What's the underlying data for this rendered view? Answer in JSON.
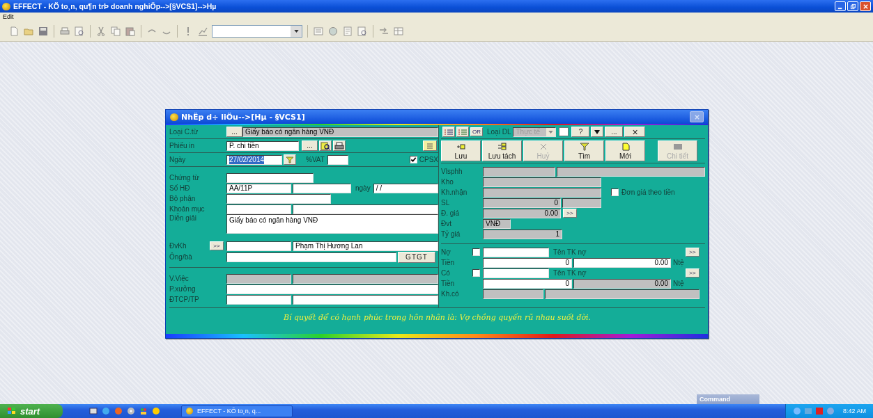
{
  "window": {
    "title": "EFFECT - KÕ to¸n, qu¶n trÞ doanh nghiÖp-->[§VCS1]-->Hµ"
  },
  "menu": [
    {
      "label": "Edit"
    }
  ],
  "dialog": {
    "title": "NhËp d÷ liÖu-->[Hµ - §VCS1]",
    "left": {
      "loai_ctu": {
        "label": "Loại C.từ",
        "button": "...",
        "field": {
          "value": "Giấy báo có ngân hàng  VNĐ",
          "disabled": true
        }
      },
      "phieu_in": {
        "label": "Phiếu in",
        "field": {
          "value": "P. chi tiền",
          "disabled": false
        },
        "button": "..."
      },
      "ngay": {
        "label": "Ngày",
        "field": {
          "value": "27/02/2014",
          "disabled": false,
          "selected": true
        },
        "vat_label": "%VAT",
        "vat": {
          "disabled": false
        },
        "cpsx": {
          "label": "CPSX",
          "checked": true
        }
      },
      "chung_tu": {
        "label": "Chứng từ",
        "field": {
          "disabled": false
        }
      },
      "so_hd": {
        "label": "Số HĐ",
        "field": {
          "value": "AA/11P",
          "disabled": false
        },
        "field_2": {
          "disabled": false
        },
        "date_label": "ngày",
        "date": {
          "value": "/ /",
          "disabled": false
        }
      },
      "bo_phan": {
        "label": "Bộ phận",
        "field": {
          "disabled": false
        }
      },
      "khoan_muc": {
        "label": "Khoản mục",
        "field": {
          "disabled": false
        },
        "field_2": {
          "disabled": false
        }
      },
      "dien_giai": {
        "label": "Diễn giải",
        "field": {
          "value": "Giấy báo có ngân hàng  VNĐ",
          "disabled": false
        }
      },
      "dvkh": {
        "label": "ĐvKh",
        "button": ">>",
        "field": {
          "disabled": false
        },
        "field_2": {
          "value": "Phạm Thị Hương Lan",
          "disabled": false
        }
      },
      "ong_ba": {
        "label": "Ông/bà",
        "field": {
          "disabled": false
        },
        "button": "GTGT"
      },
      "v_viec": {
        "label": "V.Việc",
        "field": {
          "disabled": true
        },
        "field_2": {
          "disabled": true
        }
      },
      "p_xuong": {
        "label": "P.xưởng",
        "field": {
          "disabled": false
        }
      },
      "dtcp": {
        "label": "ĐTCP/TP",
        "field": {
          "disabled": false
        },
        "field_2": {
          "disabled": false
        }
      }
    },
    "right": {
      "toolbar": {
        "or": "OR",
        "loai_dl_label": "Loại DL",
        "loai_dl": {
          "value": "Thực tế",
          "disabled": true
        },
        "help": "?",
        "more": "...",
        "close": "×"
      },
      "actions": [
        {
          "label": "Lưu",
          "disabled": false
        },
        {
          "label": "Lưu tách",
          "disabled": false
        },
        {
          "label": "Huỷ",
          "disabled": true
        },
        {
          "label": "Tìm",
          "disabled": false
        },
        {
          "label": "Mới",
          "disabled": false
        },
        {
          "label": "Chi tiết",
          "disabled": true
        }
      ],
      "vlsphh": {
        "label": "Vlsphh",
        "field": {
          "disabled": true
        },
        "field_2": {
          "disabled": true
        }
      },
      "kho": {
        "label": "Kho",
        "field": {
          "disabled": true
        }
      },
      "kh_nhan": {
        "label": "Kh.nhận",
        "field": {
          "disabled": true
        }
      },
      "don_gia_theo_tien": {
        "label": "Đơn giá theo tiền",
        "checked": false
      },
      "sl": {
        "label": "SL",
        "field": {
          "value": "0",
          "disabled": true
        },
        "field_2": {
          "disabled": true
        }
      },
      "don_gia": {
        "label": "Đ. giá",
        "field": {
          "value": "0.00",
          "disabled": true
        },
        "button": ">>"
      },
      "dvt": {
        "label": "Đvt",
        "field": {
          "value": "VNĐ",
          "disabled": true
        }
      },
      "ty_gia": {
        "label": "Tỷ giá",
        "field": {
          "value": "1",
          "disabled": true
        }
      },
      "no": {
        "label": "Nợ",
        "checked": false,
        "field": {
          "disabled": false
        },
        "account_name": "Tên TK nợ",
        "button": ">>"
      },
      "tien_no": {
        "label": "Tiền",
        "field": {
          "value": "0",
          "disabled": false
        },
        "field_2": {
          "value": "0.00",
          "disabled": false
        },
        "unit": "Ntệ"
      },
      "co": {
        "label": "Có",
        "checked": false,
        "field": {
          "disabled": false
        },
        "account_name": "Tên TK nợ",
        "button": ">>"
      },
      "tien_co": {
        "label": "Tiền",
        "field": {
          "value": "0",
          "disabled": false
        },
        "field_2": {
          "value": "0.00",
          "disabled": true
        },
        "unit": "Ntệ"
      },
      "kh_co": {
        "label": "Kh.có",
        "field": {
          "disabled": true
        },
        "field_2": {
          "disabled": true
        }
      }
    },
    "marquee": "Bí quyết để có hạnh phúc trong hôn nhân là: Vợ chồng quyến rũ nhau suốt đời."
  },
  "command_panel": {
    "title": "Command"
  },
  "taskbar": {
    "start": "start",
    "tasks": [
      {
        "label": "EFFECT - KÕ to¸n, q...",
        "selected": false
      }
    ],
    "clock": "8:42 AM"
  }
}
